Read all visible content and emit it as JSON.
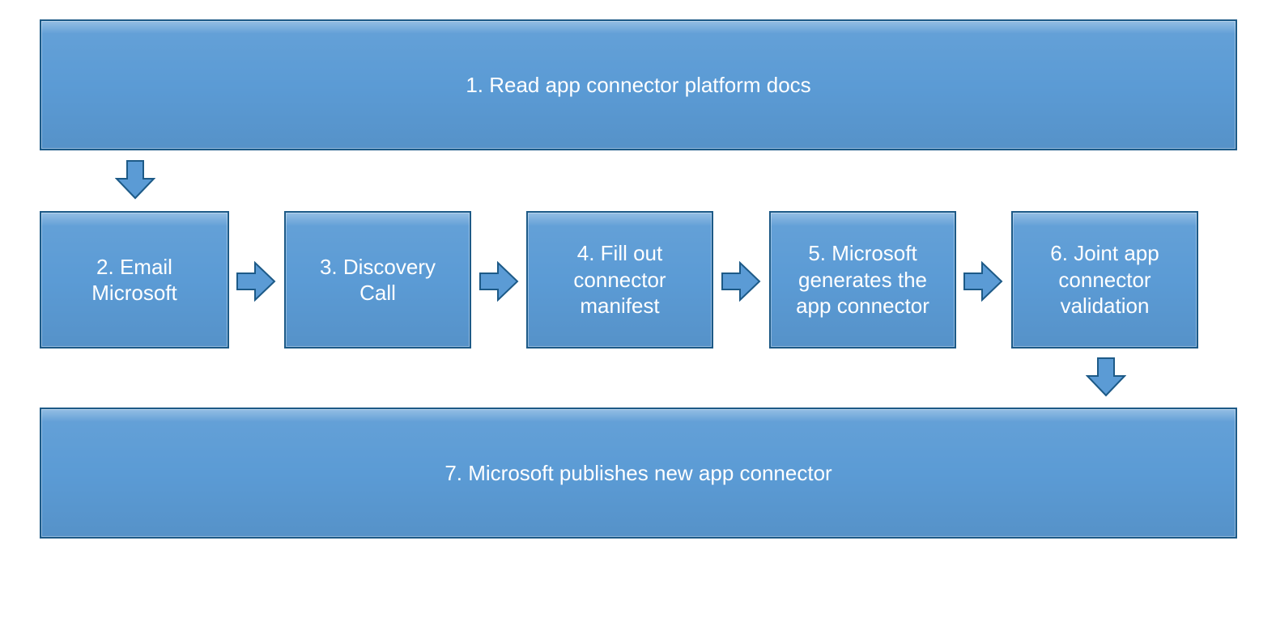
{
  "diagram": {
    "steps": {
      "s1": "1. Read app connector platform docs",
      "s2": "2. Email Microsoft",
      "s3": "3. Discovery Call",
      "s4": "4. Fill out connector manifest",
      "s5": "5. Microsoft generates the app connector",
      "s6": "6. Joint app connector validation",
      "s7": "7. Microsoft publishes new app connector"
    },
    "colors": {
      "fill": "#5b9bd5",
      "border": "#1d5a87",
      "text": "#ffffff"
    }
  }
}
